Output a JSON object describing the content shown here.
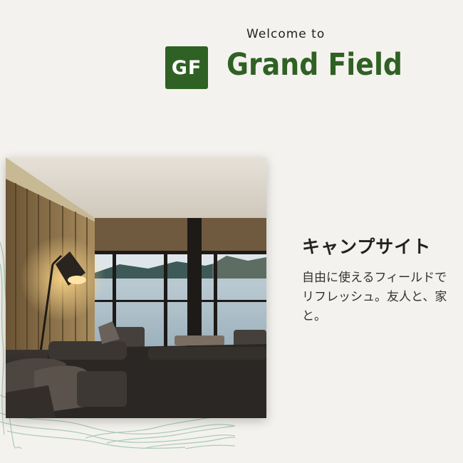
{
  "header": {
    "welcome_text": "Welcome to",
    "logo_mark": "GF",
    "brand_name": "Grand Field"
  },
  "feature": {
    "image_icon": "lake-cabin-living-room-photo",
    "title": "キャンプサイト",
    "body_lines": [
      "自由に使えるフィールドで",
      "リフレッシュ。友人と、家",
      "と。"
    ]
  },
  "colors": {
    "background": "#f4f2ee",
    "brand_green": "#2f6124",
    "topo_lines": "#9fc4ad"
  }
}
